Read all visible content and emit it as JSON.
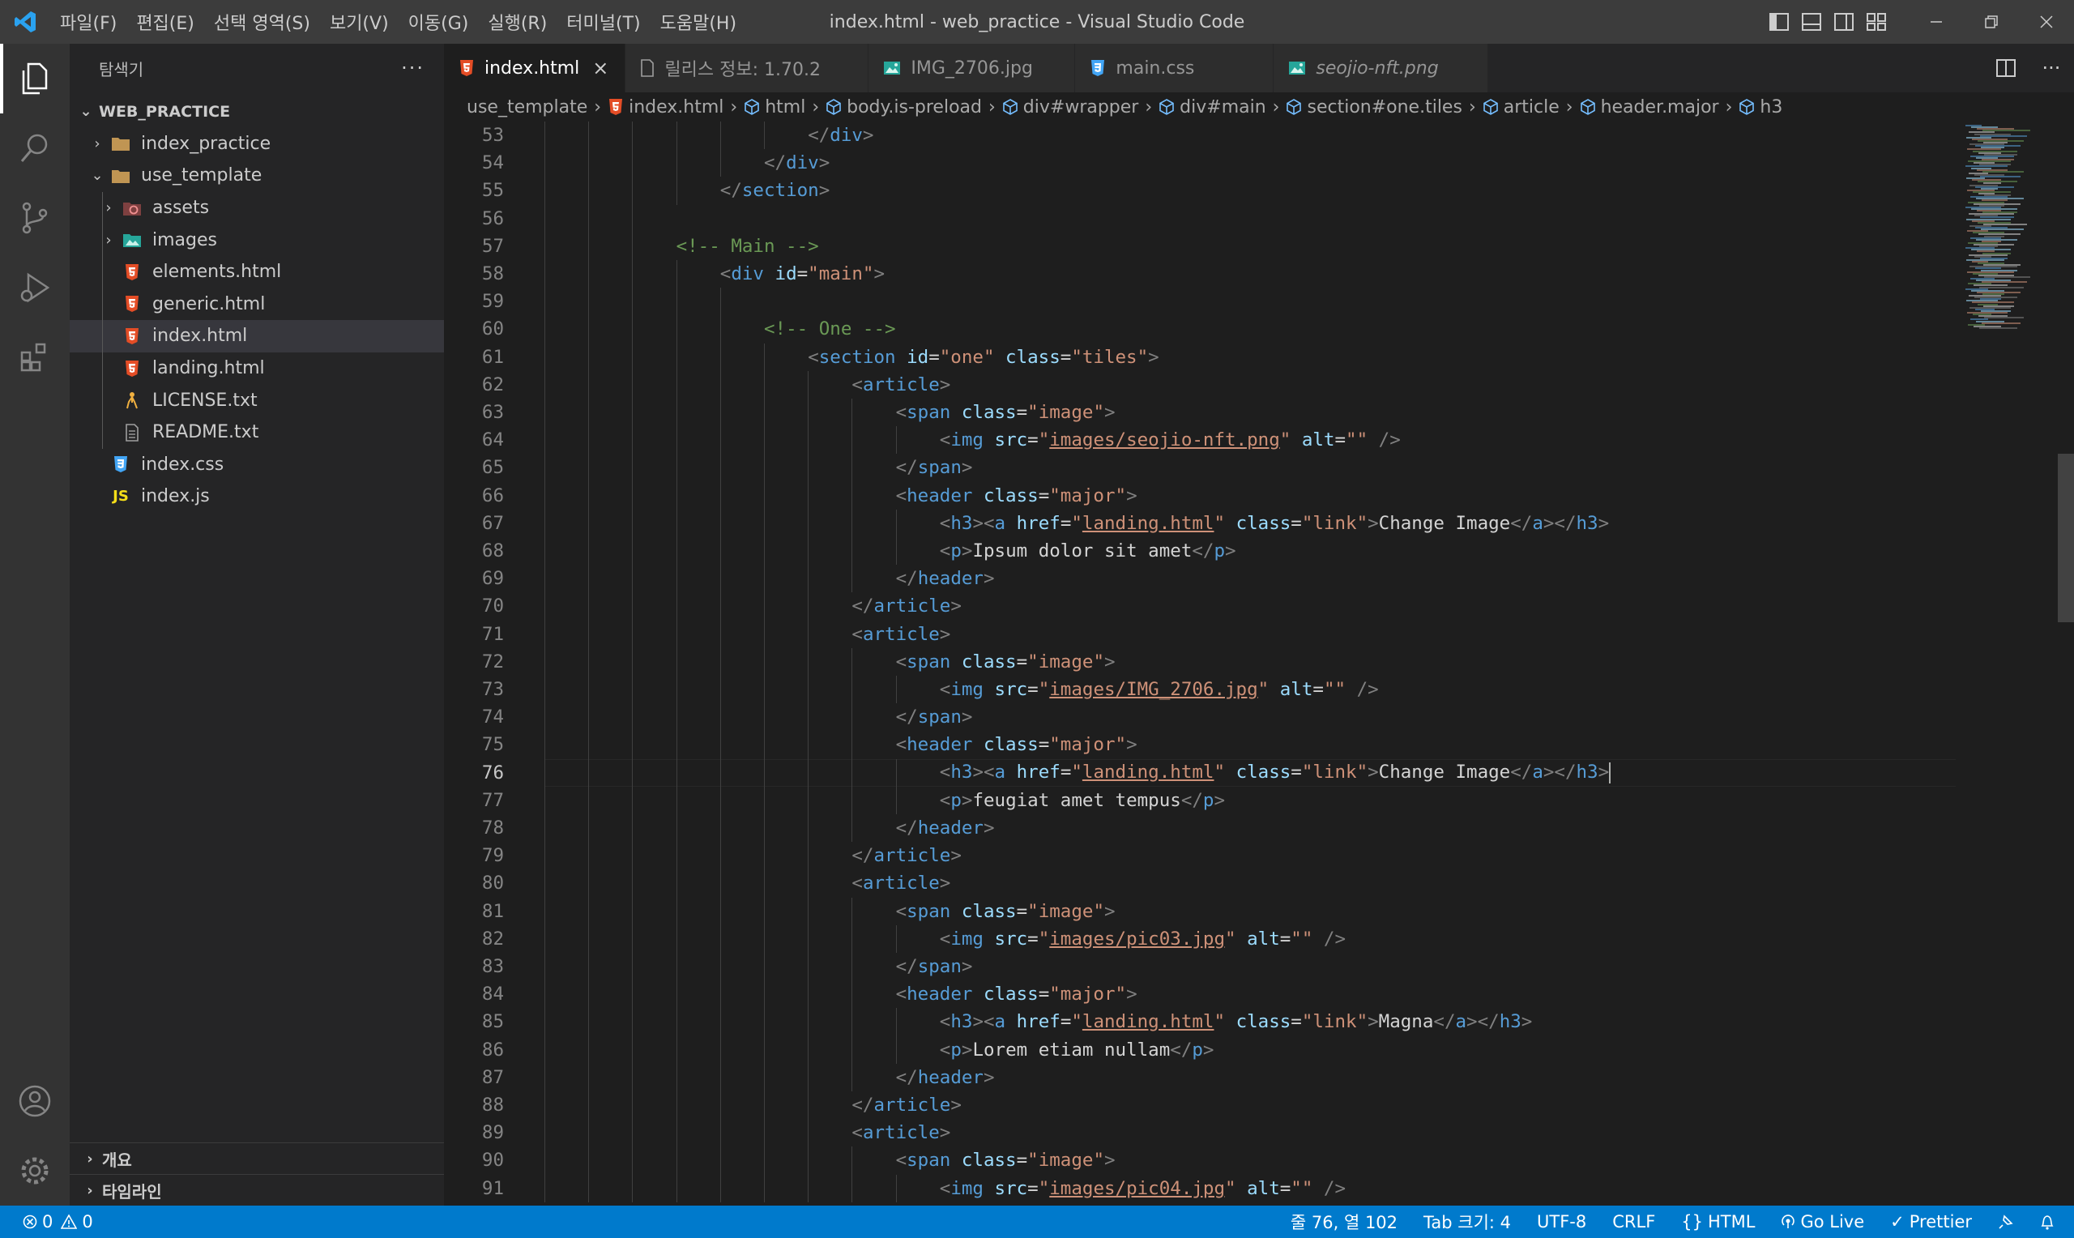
{
  "window": {
    "title": "index.html - web_practice - Visual Studio Code",
    "menu": [
      "파일(F)",
      "편집(E)",
      "선택 영역(S)",
      "보기(V)",
      "이동(G)",
      "실행(R)",
      "터미널(T)",
      "도움말(H)"
    ]
  },
  "sidebar": {
    "title": "탐색기",
    "more": "···",
    "root": "WEB_PRACTICE",
    "items": [
      {
        "label": "index_practice",
        "type": "folder",
        "depth": 1,
        "open": false
      },
      {
        "label": "use_template",
        "type": "folder",
        "depth": 1,
        "open": true
      },
      {
        "label": "assets",
        "type": "folder-assets",
        "depth": 2,
        "open": false
      },
      {
        "label": "images",
        "type": "folder-images",
        "depth": 2,
        "open": false
      },
      {
        "label": "elements.html",
        "type": "html",
        "depth": 2
      },
      {
        "label": "generic.html",
        "type": "html",
        "depth": 2
      },
      {
        "label": "index.html",
        "type": "html",
        "depth": 2,
        "selected": true
      },
      {
        "label": "landing.html",
        "type": "html",
        "depth": 2
      },
      {
        "label": "LICENSE.txt",
        "type": "license",
        "depth": 2
      },
      {
        "label": "README.txt",
        "type": "txt",
        "depth": 2
      },
      {
        "label": "index.css",
        "type": "css",
        "depth": 1
      },
      {
        "label": "index.js",
        "type": "js",
        "depth": 1
      }
    ],
    "panels": [
      "개요",
      "타임라인"
    ]
  },
  "tabs": [
    {
      "label": "index.html",
      "icon": "html",
      "active": true
    },
    {
      "label": "릴리스 정보: 1.70.2",
      "icon": "file"
    },
    {
      "label": "IMG_2706.jpg",
      "icon": "image"
    },
    {
      "label": "main.css",
      "icon": "css"
    },
    {
      "label": "seojio-nft.png",
      "icon": "image",
      "italic": true
    }
  ],
  "breadcrumb": [
    {
      "label": "use_template",
      "icon": ""
    },
    {
      "label": "index.html",
      "icon": "html"
    },
    {
      "label": "html",
      "icon": "cube"
    },
    {
      "label": "body.is-preload",
      "icon": "cube"
    },
    {
      "label": "div#wrapper",
      "icon": "cube"
    },
    {
      "label": "div#main",
      "icon": "cube"
    },
    {
      "label": "section#one.tiles",
      "icon": "cube"
    },
    {
      "label": "article",
      "icon": "cube"
    },
    {
      "label": "header.major",
      "icon": "cube"
    },
    {
      "label": "h3",
      "icon": "cube"
    }
  ],
  "editor": {
    "current_line": 76,
    "lines": [
      {
        "n": 53,
        "indent": 7,
        "code": "</div>"
      },
      {
        "n": 54,
        "indent": 6,
        "code": "</div>"
      },
      {
        "n": 55,
        "indent": 5,
        "code": "</section>"
      },
      {
        "n": 56,
        "indent": 0,
        "code": ""
      },
      {
        "n": 57,
        "indent": 4,
        "code": "<!-- Main -->"
      },
      {
        "n": 58,
        "indent": 5,
        "code": "<div id=\"main\">"
      },
      {
        "n": 59,
        "indent": 0,
        "code": ""
      },
      {
        "n": 60,
        "indent": 6,
        "code": "<!-- One -->"
      },
      {
        "n": 61,
        "indent": 7,
        "code": "<section id=\"one\" class=\"tiles\">"
      },
      {
        "n": 62,
        "indent": 8,
        "code": "<article>"
      },
      {
        "n": 63,
        "indent": 9,
        "code": "<span class=\"image\">"
      },
      {
        "n": 64,
        "indent": 10,
        "code": "<img src=\"images/seojio-nft.png\" alt=\"\" />"
      },
      {
        "n": 65,
        "indent": 9,
        "code": "</span>"
      },
      {
        "n": 66,
        "indent": 9,
        "code": "<header class=\"major\">"
      },
      {
        "n": 67,
        "indent": 10,
        "code": "<h3><a href=\"landing.html\" class=\"link\">Change Image</a></h3>"
      },
      {
        "n": 68,
        "indent": 10,
        "code": "<p>Ipsum dolor sit amet</p>"
      },
      {
        "n": 69,
        "indent": 9,
        "code": "</header>"
      },
      {
        "n": 70,
        "indent": 8,
        "code": "</article>"
      },
      {
        "n": 71,
        "indent": 8,
        "code": "<article>"
      },
      {
        "n": 72,
        "indent": 9,
        "code": "<span class=\"image\">"
      },
      {
        "n": 73,
        "indent": 10,
        "code": "<img src=\"images/IMG_2706.jpg\" alt=\"\" />"
      },
      {
        "n": 74,
        "indent": 9,
        "code": "</span>"
      },
      {
        "n": 75,
        "indent": 9,
        "code": "<header class=\"major\">"
      },
      {
        "n": 76,
        "indent": 10,
        "code": "<h3><a href=\"landing.html\" class=\"link\">Change Image</a></h3>"
      },
      {
        "n": 77,
        "indent": 10,
        "code": "<p>feugiat amet tempus</p>"
      },
      {
        "n": 78,
        "indent": 9,
        "code": "</header>"
      },
      {
        "n": 79,
        "indent": 8,
        "code": "</article>"
      },
      {
        "n": 80,
        "indent": 8,
        "code": "<article>"
      },
      {
        "n": 81,
        "indent": 9,
        "code": "<span class=\"image\">"
      },
      {
        "n": 82,
        "indent": 10,
        "code": "<img src=\"images/pic03.jpg\" alt=\"\" />"
      },
      {
        "n": 83,
        "indent": 9,
        "code": "</span>"
      },
      {
        "n": 84,
        "indent": 9,
        "code": "<header class=\"major\">"
      },
      {
        "n": 85,
        "indent": 10,
        "code": "<h3><a href=\"landing.html\" class=\"link\">Magna</a></h3>"
      },
      {
        "n": 86,
        "indent": 10,
        "code": "<p>Lorem etiam nullam</p>"
      },
      {
        "n": 87,
        "indent": 9,
        "code": "</header>"
      },
      {
        "n": 88,
        "indent": 8,
        "code": "</article>"
      },
      {
        "n": 89,
        "indent": 8,
        "code": "<article>"
      },
      {
        "n": 90,
        "indent": 9,
        "code": "<span class=\"image\">"
      },
      {
        "n": 91,
        "indent": 10,
        "code": "<img src=\"images/pic04.jpg\" alt=\"\" />"
      }
    ]
  },
  "statusbar": {
    "errors": "0",
    "warnings": "0",
    "position": "줄 76, 열 102",
    "tab_size": "Tab 크기: 4",
    "encoding": "UTF-8",
    "eol": "CRLF",
    "language": "HTML",
    "go_live": "Go Live",
    "prettier": "Prettier"
  },
  "colors": {
    "accent": "#007acc",
    "html_icon": "#e44d26",
    "css_icon": "#42a5f5",
    "js_icon": "#f5de19",
    "image_icon": "#26a69a"
  }
}
